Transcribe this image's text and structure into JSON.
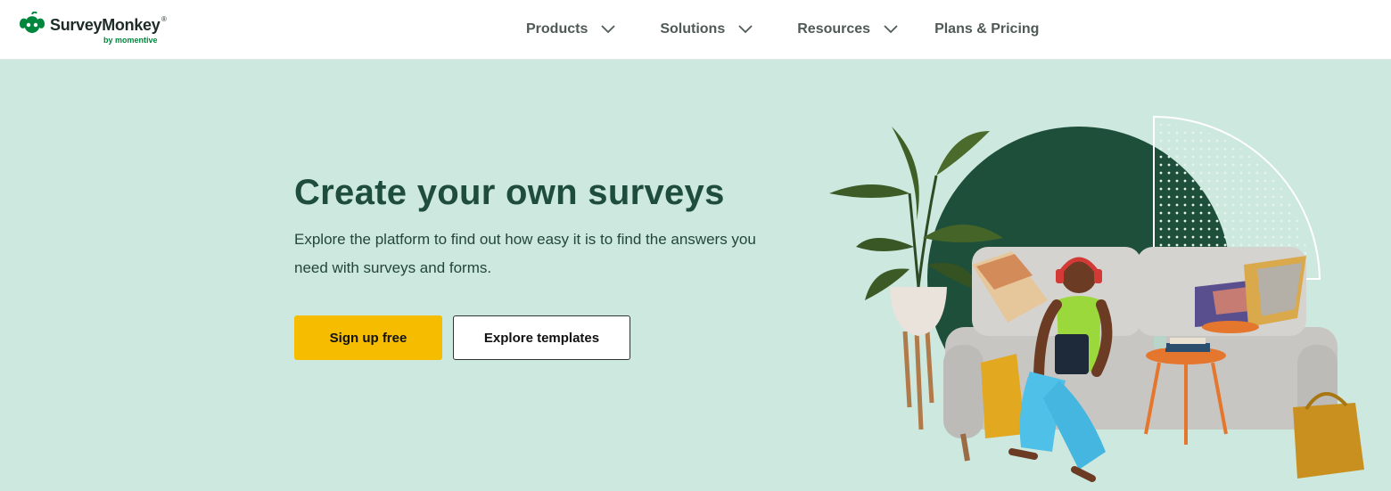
{
  "brand": {
    "name": "SurveyMonkey",
    "trademark": "®",
    "byline": "by momentive",
    "color_primary": "#00873d"
  },
  "nav": {
    "products": "Products",
    "solutions": "Solutions",
    "resources": "Resources",
    "pricing": "Plans & Pricing",
    "chevron_icon": "chevron-down-icon"
  },
  "hero": {
    "title": "Create your own surveys",
    "subtitle": "Explore the platform to find out how easy it is to find the answers you need with surveys and forms.",
    "primary_button": "Sign up free",
    "secondary_button": "Explore templates",
    "background_color": "#cde8de",
    "title_color": "#1e4d3e",
    "primary_button_color": "#f6bd00"
  }
}
